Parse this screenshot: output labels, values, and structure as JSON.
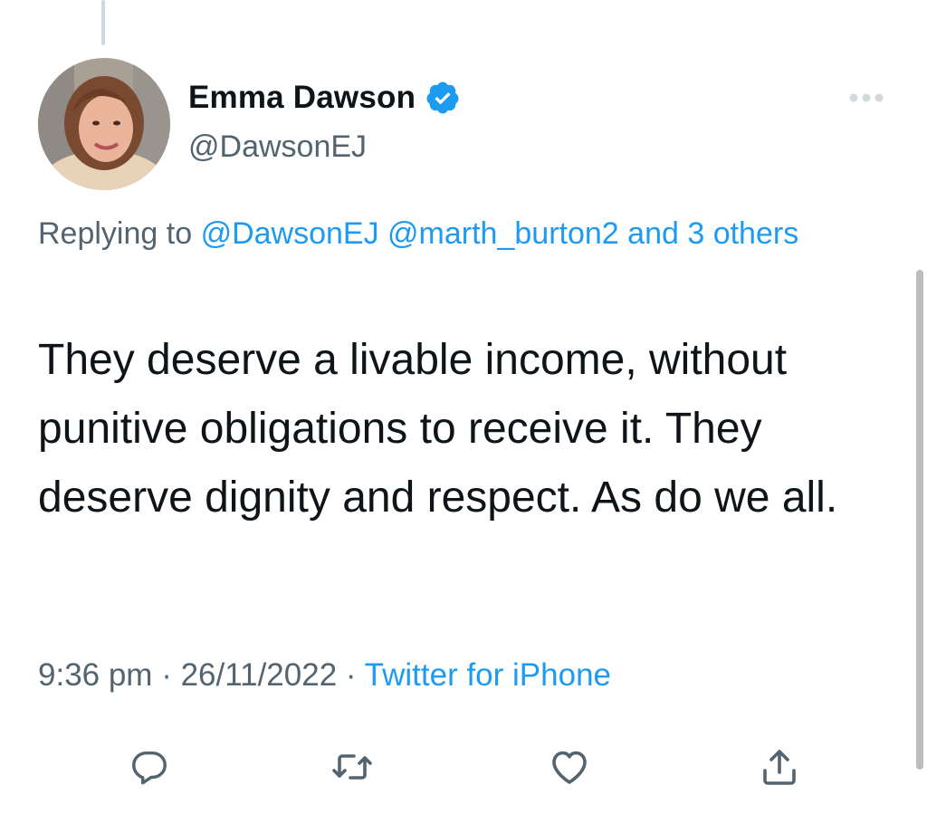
{
  "tweet": {
    "author": {
      "display_name": "Emma Dawson",
      "handle": "@DawsonEJ",
      "verified": true
    },
    "reply_prefix": "Replying to",
    "reply_mentions": [
      "@DawsonEJ",
      "@marth_burton2"
    ],
    "reply_connector": "and",
    "reply_others": "3 others",
    "text": "They deserve a livable income, without punitive obligations to receive it. They deserve dignity and respect. As do we all.",
    "time": "9:36 pm",
    "date": "26/11/2022",
    "separator": "·",
    "source": "Twitter for iPhone"
  },
  "icons": {
    "verified": "verified-badge-icon",
    "more": "more-options-icon",
    "reply": "reply-icon",
    "retweet": "retweet-icon",
    "like": "like-heart-icon",
    "share": "share-icon"
  },
  "colors": {
    "accent": "#1d9bf0",
    "text_primary": "#0f1419",
    "text_secondary": "#536471",
    "thread_line": "#cfd9de"
  }
}
